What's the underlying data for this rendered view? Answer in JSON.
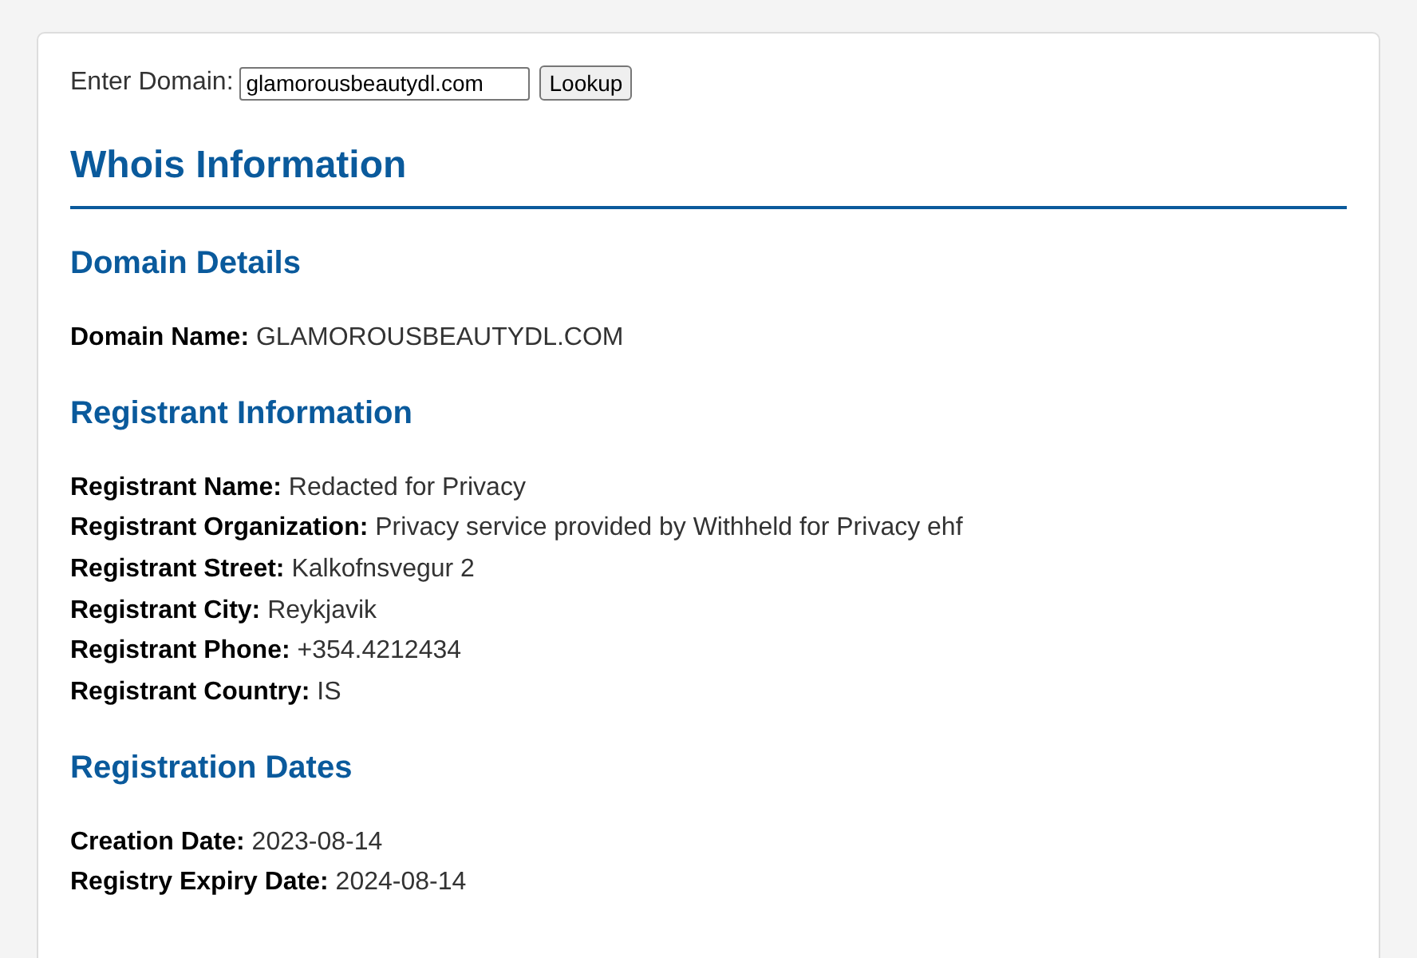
{
  "lookup": {
    "label": "Enter Domain:",
    "value": "glamorousbeautydl.com",
    "button": "Lookup"
  },
  "title": "Whois Information",
  "sections": [
    {
      "heading": "Domain Details",
      "fields": [
        {
          "label": "Domain Name:",
          "value": "GLAMOROUSBEAUTYDL.COM"
        }
      ]
    },
    {
      "heading": "Registrant Information",
      "fields": [
        {
          "label": "Registrant Name:",
          "value": "Redacted for Privacy"
        },
        {
          "label": "Registrant Organization:",
          "value": "Privacy service provided by Withheld for Privacy ehf"
        },
        {
          "label": "Registrant Street:",
          "value": "Kalkofnsvegur 2"
        },
        {
          "label": "Registrant City:",
          "value": "Reykjavik"
        },
        {
          "label": "Registrant Phone:",
          "value": "+354.4212434"
        },
        {
          "label": "Registrant Country:",
          "value": "IS"
        }
      ]
    },
    {
      "heading": "Registration Dates",
      "fields": [
        {
          "label": "Creation Date:",
          "value": "2023-08-14"
        },
        {
          "label": "Registry Expiry Date:",
          "value": "2024-08-14"
        }
      ]
    }
  ]
}
